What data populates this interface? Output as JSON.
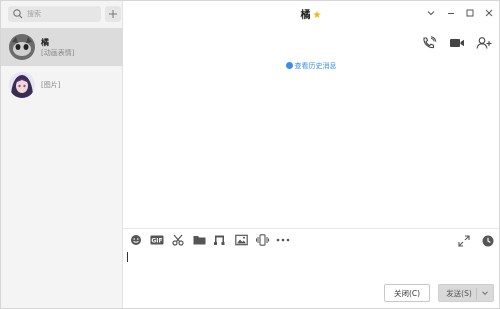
{
  "search": {
    "placeholder": "搜索"
  },
  "conversations": [
    {
      "name": "橘",
      "preview": "[动画表情]",
      "active": true
    },
    {
      "name": "",
      "preview": "[图片]",
      "active": false
    }
  ],
  "chat": {
    "title": "橘",
    "history_link": "查看历史消息"
  },
  "footer": {
    "close_label": "关闭(C)",
    "send_label": "发送(S)"
  },
  "colors": {
    "accent": "#3a8ee6",
    "star": "#f5b400",
    "active_row": "#dcdcdc",
    "sidebar_bg": "#f4f4f4"
  }
}
